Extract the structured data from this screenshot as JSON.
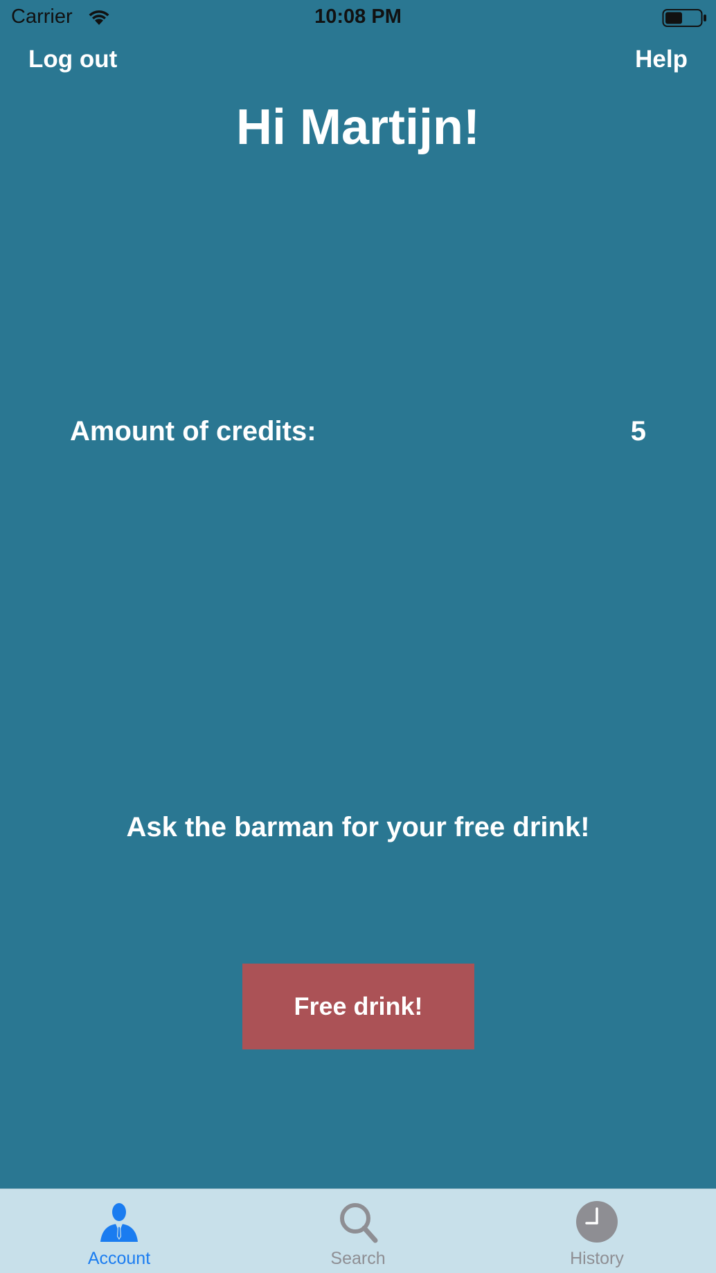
{
  "status_bar": {
    "carrier": "Carrier",
    "time": "10:08 PM",
    "wifi_icon": "wifi-icon",
    "battery_icon": "battery-icon"
  },
  "nav": {
    "logout_label": "Log out",
    "help_label": "Help"
  },
  "main": {
    "greeting": "Hi Martijn!",
    "credits_label": "Amount of credits:",
    "credits_value": "5",
    "message": "Ask the barman for your free drink!",
    "button_label": "Free drink!"
  },
  "tab_bar": {
    "tabs": [
      {
        "label": "Account",
        "icon": "account-icon",
        "active": true
      },
      {
        "label": "Search",
        "icon": "search-icon",
        "active": false
      },
      {
        "label": "History",
        "icon": "clock-icon",
        "active": false
      }
    ]
  },
  "colors": {
    "background": "#2a7792",
    "button": "#ab5256",
    "tab_bar": "#c8e0ea",
    "active_tab": "#1a7cf0",
    "inactive_tab": "#8e8e93"
  }
}
